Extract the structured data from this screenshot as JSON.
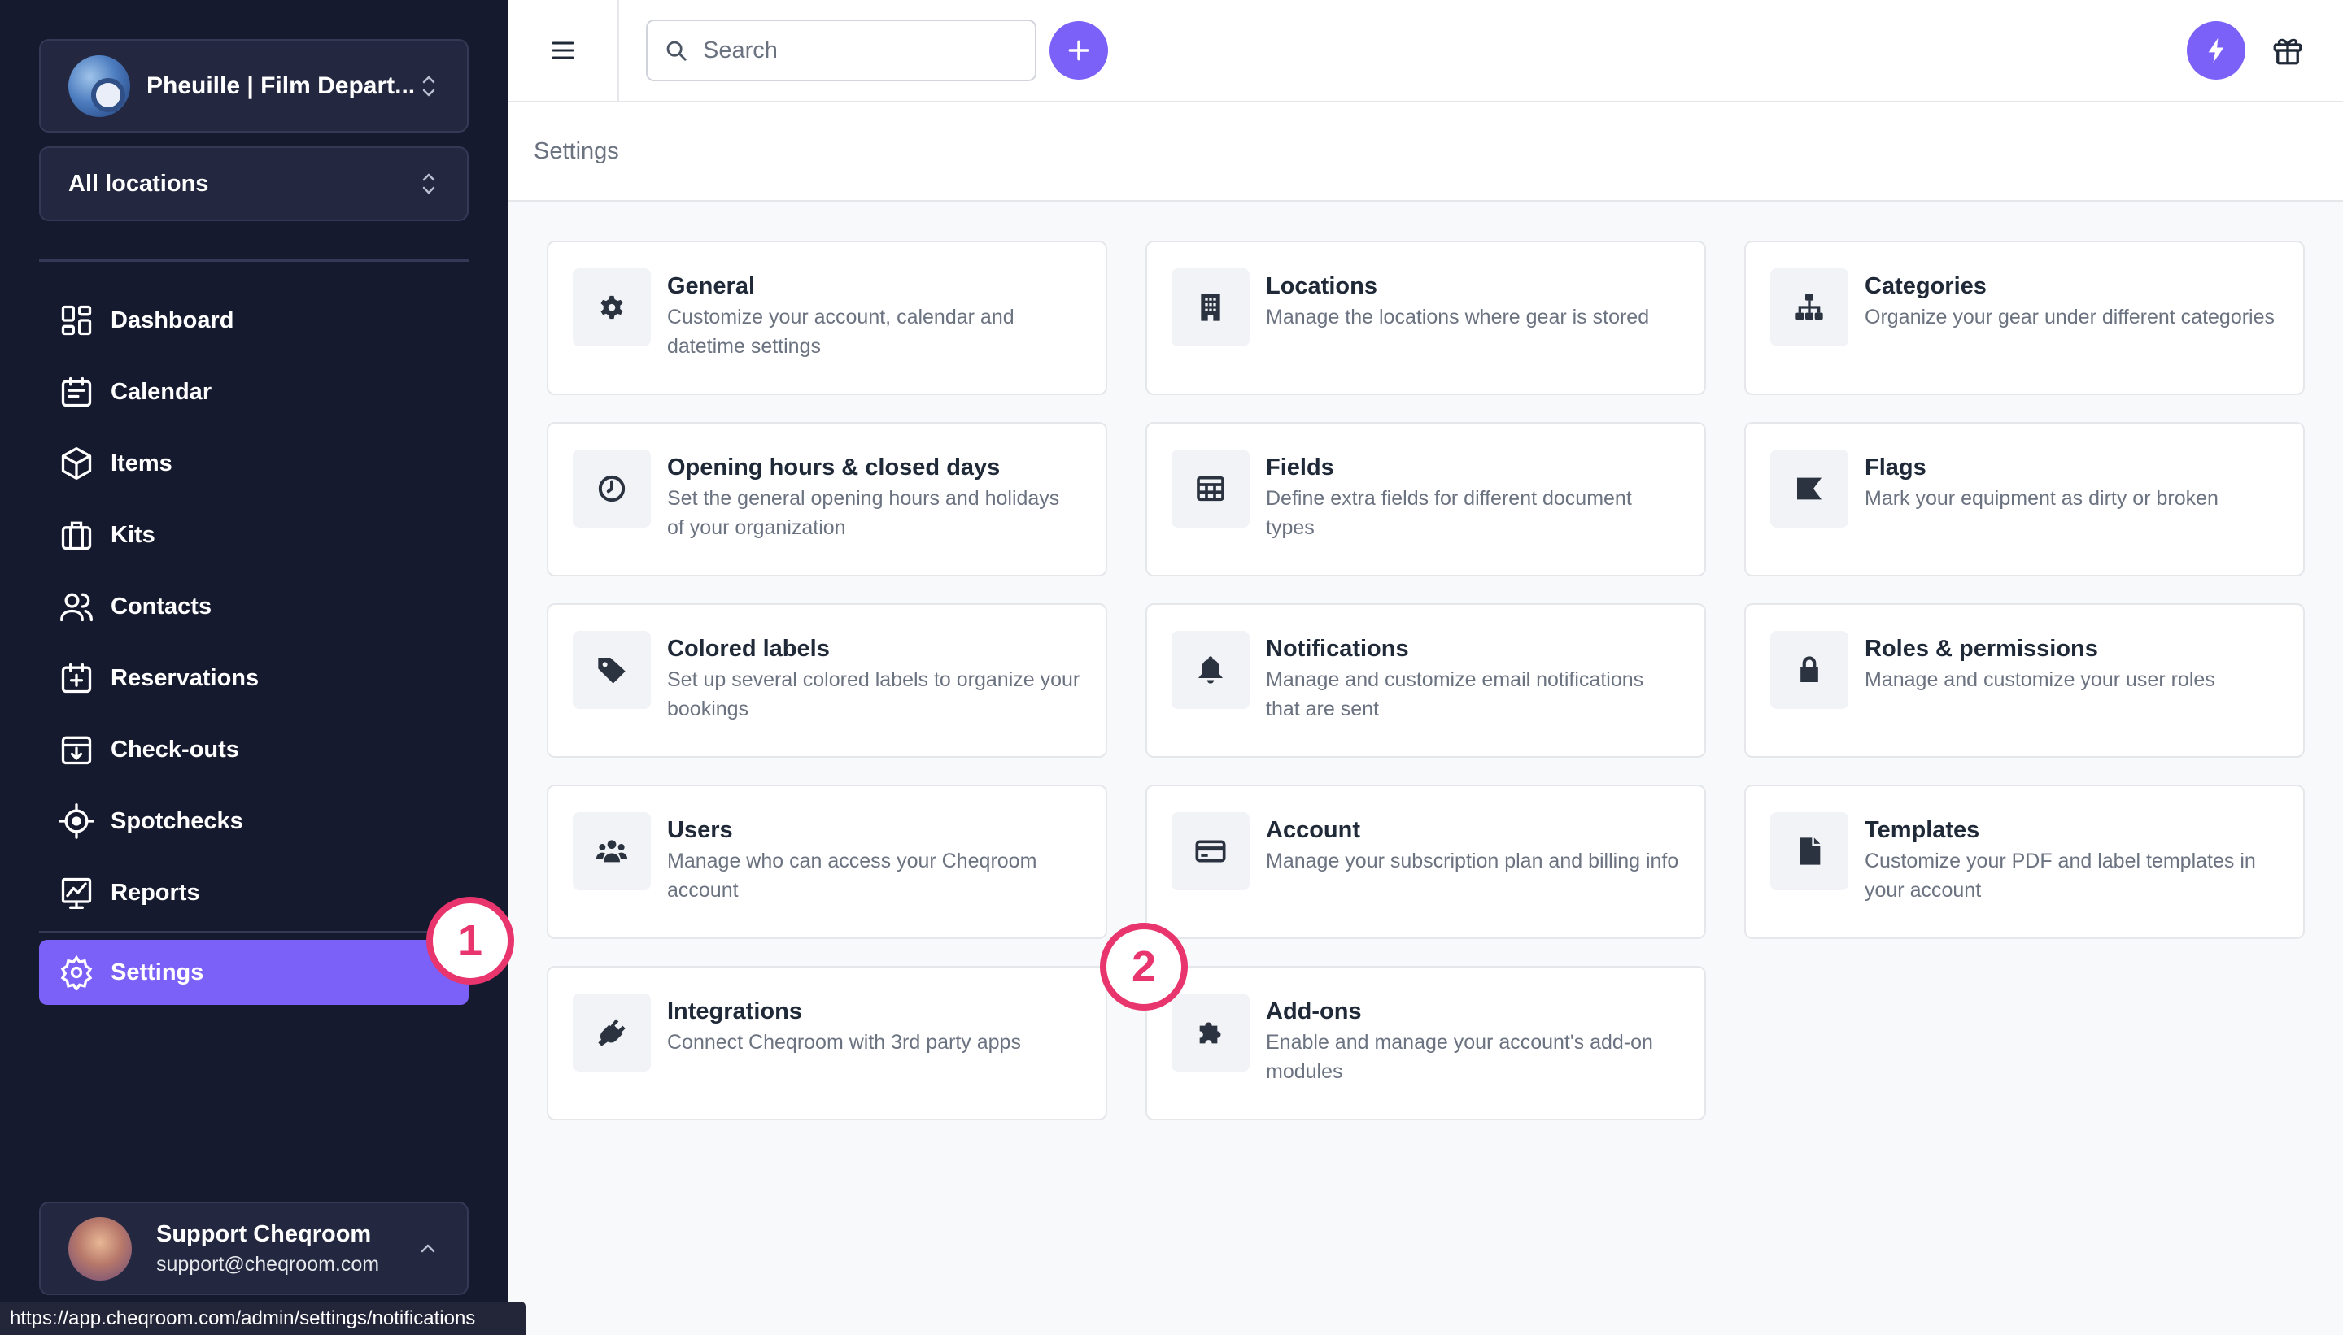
{
  "sidebar": {
    "org_name": "Pheuille | Film Depart...",
    "location_select": "All locations",
    "nav": [
      {
        "label": "Dashboard",
        "icon": "dashboard-icon"
      },
      {
        "label": "Calendar",
        "icon": "calendar-icon"
      },
      {
        "label": "Items",
        "icon": "cube-icon"
      },
      {
        "label": "Kits",
        "icon": "briefcase-icon"
      },
      {
        "label": "Contacts",
        "icon": "users-icon"
      },
      {
        "label": "Reservations",
        "icon": "calendar-plus-icon"
      },
      {
        "label": "Check-outs",
        "icon": "calendar-download-icon"
      },
      {
        "label": "Spotchecks",
        "icon": "crosshair-icon"
      },
      {
        "label": "Reports",
        "icon": "chart-icon"
      }
    ],
    "settings_label": "Settings",
    "user": {
      "name": "Support Cheqroom",
      "email": "support@cheqroom.com"
    }
  },
  "status_url": "https://app.cheqroom.com/admin/settings/notifications",
  "topbar": {
    "search_placeholder": "Search"
  },
  "page": {
    "title": "Settings"
  },
  "cards": [
    {
      "title": "General",
      "desc": "Customize your account, calendar and datetime settings",
      "icon": "gear-icon"
    },
    {
      "title": "Locations",
      "desc": "Manage the locations where gear is stored",
      "icon": "building-icon"
    },
    {
      "title": "Categories",
      "desc": "Organize your gear under different categories",
      "icon": "hierarchy-icon"
    },
    {
      "title": "Opening hours & closed days",
      "desc": "Set the general opening hours and holidays of your organization",
      "icon": "clock-icon"
    },
    {
      "title": "Fields",
      "desc": "Define extra fields for different document types",
      "icon": "table-icon"
    },
    {
      "title": "Flags",
      "desc": "Mark your equipment as dirty or broken",
      "icon": "flag-icon"
    },
    {
      "title": "Colored labels",
      "desc": "Set up several colored labels to organize your bookings",
      "icon": "tag-icon"
    },
    {
      "title": "Notifications",
      "desc": "Manage and customize email notifications that are sent",
      "icon": "bell-icon"
    },
    {
      "title": "Roles & permissions",
      "desc": "Manage and customize your user roles",
      "icon": "lock-icon"
    },
    {
      "title": "Users",
      "desc": "Manage who can access your Cheqroom account",
      "icon": "users-icon"
    },
    {
      "title": "Account",
      "desc": "Manage your subscription plan and billing info",
      "icon": "credit-card-icon"
    },
    {
      "title": "Templates",
      "desc": "Customize your PDF and label templates in your account",
      "icon": "document-icon"
    },
    {
      "title": "Integrations",
      "desc": "Connect Cheqroom with 3rd party apps",
      "icon": "plug-icon"
    },
    {
      "title": "Add-ons",
      "desc": "Enable and manage your account's add-on modules",
      "icon": "puzzle-icon"
    }
  ],
  "markers": [
    "1",
    "2"
  ],
  "colors": {
    "accent": "#7b61f8",
    "sidebar": "#161a2e",
    "marker": "#e8356d"
  }
}
